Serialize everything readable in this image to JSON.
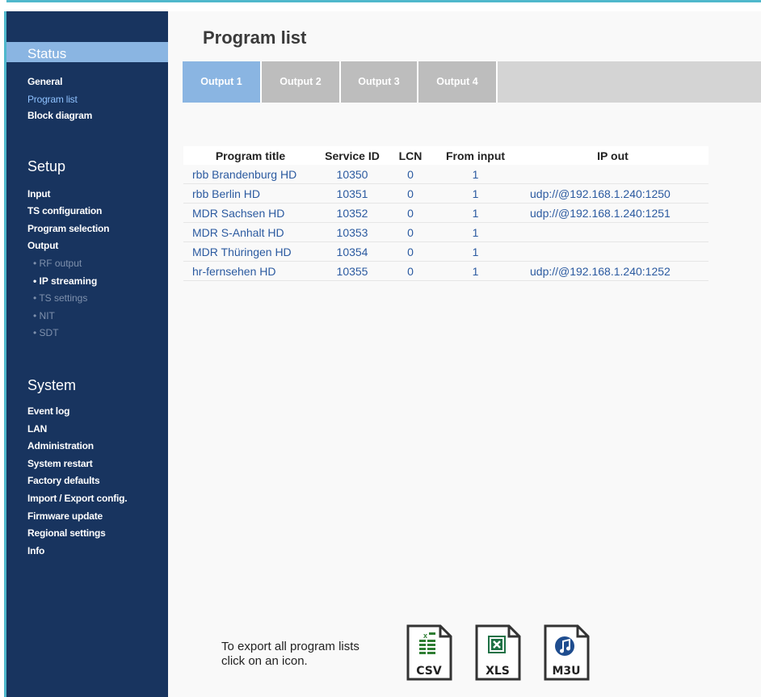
{
  "sidebar": {
    "status": {
      "header": "Status",
      "items": [
        "General",
        "Program list",
        "Block diagram"
      ]
    },
    "setup": {
      "header": "Setup",
      "items": [
        "Input",
        "TS configuration",
        "Program selection",
        "Output"
      ],
      "output_sub": [
        "• RF output",
        "• IP streaming",
        "• TS settings",
        "• NIT",
        "• SDT"
      ]
    },
    "system": {
      "header": "System",
      "items": [
        "Event log",
        "LAN",
        "Administration",
        "System restart",
        "Factory defaults",
        "Import / Export config.",
        "Firmware update",
        "Regional settings",
        "Info"
      ]
    }
  },
  "page_title": "Program list",
  "tabs": [
    "Output 1",
    "Output 2",
    "Output 3",
    "Output 4"
  ],
  "active_tab": "Output 1",
  "table": {
    "headers": [
      "Program title",
      "Service ID",
      "LCN",
      "From input",
      "IP out"
    ],
    "rows": [
      [
        "rbb Brandenburg HD",
        "10350",
        "0",
        "1",
        ""
      ],
      [
        "rbb Berlin HD",
        "10351",
        "0",
        "1",
        "udp://@192.168.1.240:1250"
      ],
      [
        "MDR Sachsen HD",
        "10352",
        "0",
        "1",
        "udp://@192.168.1.240:1251"
      ],
      [
        "MDR S-Anhalt HD",
        "10353",
        "0",
        "1",
        ""
      ],
      [
        "MDR Thüringen HD",
        "10354",
        "0",
        "1",
        ""
      ],
      [
        "hr-fernsehen HD",
        "10355",
        "0",
        "1",
        "udp://@192.168.1.240:1252"
      ]
    ]
  },
  "export": {
    "text_line1": "To export all program lists",
    "text_line2": "click on an icon.",
    "icons": [
      {
        "name": "csv-icon",
        "label": "CSV"
      },
      {
        "name": "xls-icon",
        "label": "XLS"
      },
      {
        "name": "m3u-icon",
        "label": "M3U"
      }
    ]
  },
  "colors": {
    "sidebar_bg": "#18345f",
    "accent": "#8ab5e2",
    "link": "#2b5aa0",
    "excel_green": "#1e7145",
    "m3u_blue": "#1f4d8f"
  }
}
